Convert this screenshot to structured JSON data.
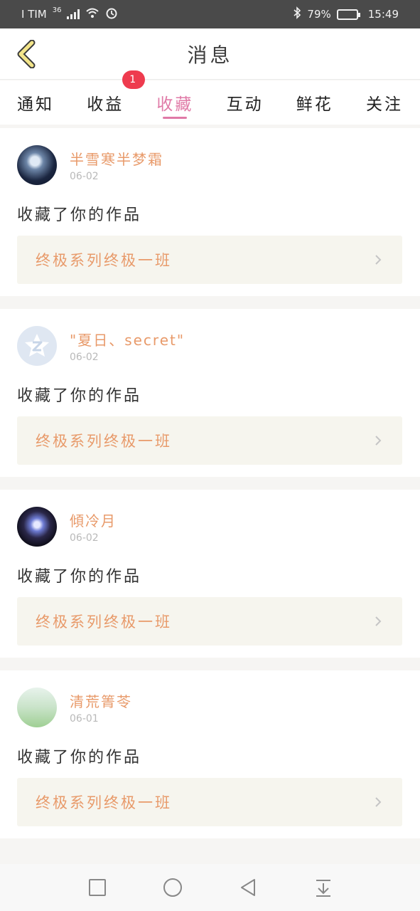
{
  "status": {
    "carrier": "I TIM",
    "network": "36",
    "battery_pct": "79%",
    "battery_level": 0.79,
    "time": "15:49"
  },
  "header": {
    "title": "消息"
  },
  "tabs": [
    {
      "label": "通知"
    },
    {
      "label": "收益",
      "badge": "1"
    },
    {
      "label": "收藏",
      "active": true
    },
    {
      "label": "互动"
    },
    {
      "label": "鲜花"
    },
    {
      "label": "关注"
    }
  ],
  "cards": [
    {
      "username": "半雪寒半梦霜",
      "date": "06-02",
      "action": "收藏了你的作品",
      "work_title": "终极系列终极一班"
    },
    {
      "username": "\"夏日、secret\"",
      "date": "06-02",
      "action": "收藏了你的作品",
      "work_title": "终极系列终极一班"
    },
    {
      "username": "傾冷月",
      "date": "06-02",
      "action": "收藏了你的作品",
      "work_title": "终极系列终极一班"
    },
    {
      "username": "清荒箐苓",
      "date": "06-01",
      "action": "收藏了你的作品",
      "work_title": "终极系列终极一班"
    }
  ],
  "colors": {
    "accent": "#e07aa7",
    "username": "#e89a6a",
    "badge": "#ee3b4e",
    "status_bar": "#4a4a4a"
  },
  "icons": {
    "back": "chevron-left-icon",
    "nav_recent": "square-icon",
    "nav_home": "circle-icon",
    "nav_back": "triangle-back-icon",
    "nav_down": "collapse-down-icon"
  }
}
